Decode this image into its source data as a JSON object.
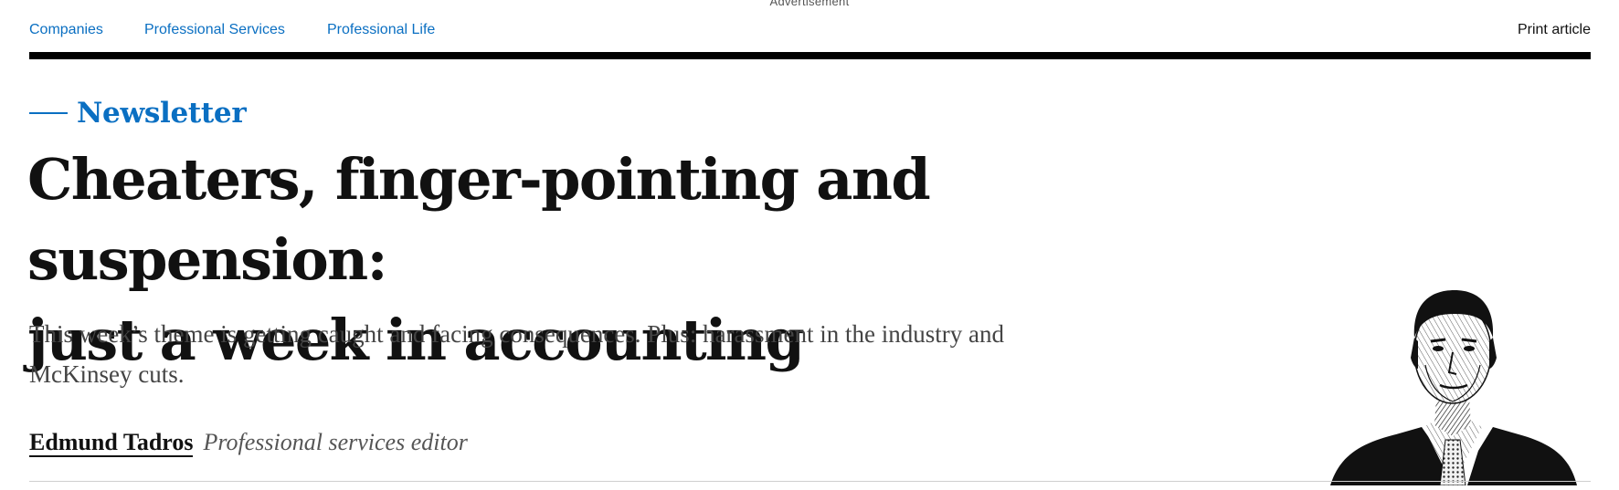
{
  "advertisement": {
    "label": "Advertisement"
  },
  "topnav": {
    "links": [
      {
        "label": "Companies"
      },
      {
        "label": "Professional Services"
      },
      {
        "label": "Professional Life"
      }
    ],
    "print_label": "Print article"
  },
  "article": {
    "kicker": "Newsletter",
    "headline_line1": "Cheaters, finger-pointing and suspension:",
    "headline_line2": "just a week in accounting",
    "standfirst_line1": "This week’s theme is getting caught and facing consequences. Plus: harassment in the industry and",
    "standfirst_line2": "McKinsey cuts.",
    "author": {
      "name": "Edmund Tadros",
      "role": "Professional services editor"
    }
  },
  "colors": {
    "accent": "#0a6fc2",
    "text": "#111111",
    "muted": "#444444",
    "rule": "#000000"
  },
  "icons": {
    "portrait": "author-portrait-illustration"
  }
}
